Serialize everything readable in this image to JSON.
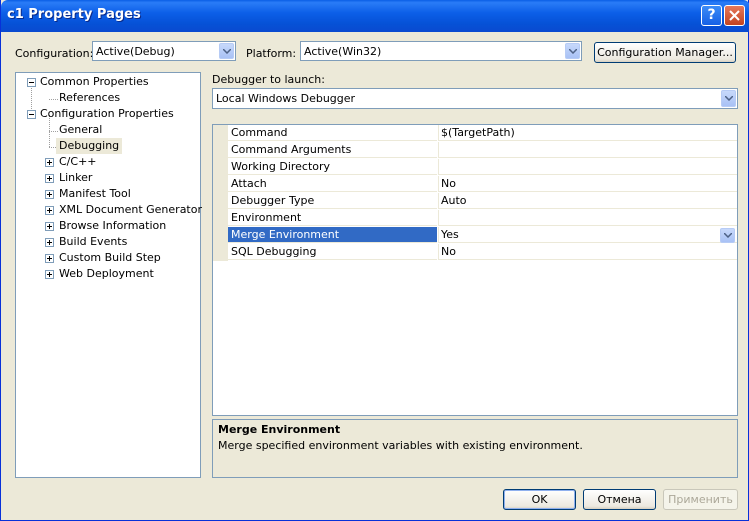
{
  "window": {
    "title": "c1 Property Pages",
    "help_icon": "?",
    "close_icon": "x"
  },
  "config_bar": {
    "configuration_label": "Configuration:",
    "configuration_value": "Active(Debug)",
    "platform_label": "Platform:",
    "platform_value": "Active(Win32)",
    "manager_button": "Configuration Manager..."
  },
  "tree": {
    "nodes": [
      {
        "label": "Common Properties",
        "expander": "minus"
      },
      {
        "label": "References"
      },
      {
        "label": "Configuration Properties",
        "expander": "minus"
      },
      {
        "label": "General"
      },
      {
        "label": "Debugging",
        "selected": true
      },
      {
        "label": "C/C++",
        "expander": "plus"
      },
      {
        "label": "Linker",
        "expander": "plus"
      },
      {
        "label": "Manifest Tool",
        "expander": "plus"
      },
      {
        "label": "XML Document Generator",
        "expander": "plus"
      },
      {
        "label": "Browse Information",
        "expander": "plus"
      },
      {
        "label": "Build Events",
        "expander": "plus"
      },
      {
        "label": "Custom Build Step",
        "expander": "plus"
      },
      {
        "label": "Web Deployment",
        "expander": "plus"
      }
    ]
  },
  "debugger": {
    "launch_label": "Debugger to launch:",
    "launch_value": "Local Windows Debugger"
  },
  "properties": {
    "rows": [
      {
        "name": "Command",
        "value": "$(TargetPath)"
      },
      {
        "name": "Command Arguments",
        "value": ""
      },
      {
        "name": "Working Directory",
        "value": ""
      },
      {
        "name": "Attach",
        "value": "No"
      },
      {
        "name": "Debugger Type",
        "value": "Auto"
      },
      {
        "name": "Environment",
        "value": ""
      },
      {
        "name": "Merge Environment",
        "value": "Yes",
        "selected": true
      },
      {
        "name": "SQL Debugging",
        "value": "No"
      }
    ]
  },
  "description": {
    "title": "Merge Environment",
    "text": "Merge specified environment variables with existing environment."
  },
  "buttons": {
    "ok": "OK",
    "cancel": "Отмена",
    "apply": "Применить"
  },
  "colors": {
    "title_bar": "#0a5ee6",
    "selection": "#316ac5",
    "dialog_bg": "#ece9d8"
  }
}
